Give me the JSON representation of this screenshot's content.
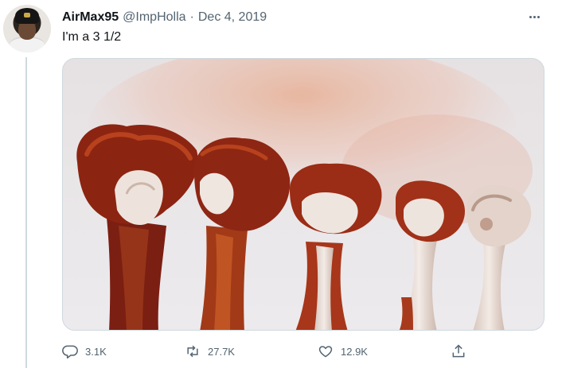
{
  "tweet": {
    "display_name": "AirMax95",
    "handle": "@ImpHolla",
    "separator": "·",
    "date": "Dec 4, 2019",
    "text": "I'm a 3 1/2"
  },
  "actions": {
    "reply": {
      "icon": "reply-icon",
      "count": "3.1K"
    },
    "retweet": {
      "icon": "retweet-icon",
      "count": "27.7K"
    },
    "like": {
      "icon": "heart-icon",
      "count": "12.9K"
    },
    "share": {
      "icon": "share-icon"
    }
  },
  "colors": {
    "text_primary": "#0f1419",
    "text_secondary": "#536471",
    "border": "#cfd9de"
  }
}
